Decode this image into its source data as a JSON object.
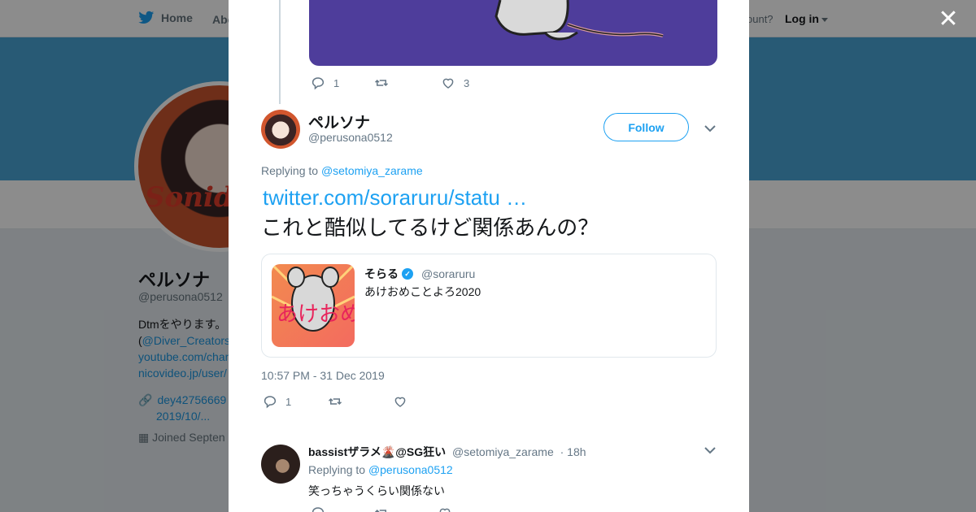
{
  "topbar": {
    "home_label": "Home",
    "about_label": "Abo",
    "account_prompt": "ccount?",
    "login_label": "Log in",
    "twitter_color": "#1da1f2"
  },
  "profile": {
    "avatar_watermark": "Sonid",
    "name": "ペルソナ",
    "handle": "@perusona0512",
    "bio_line1": "Dtmをやります。",
    "bio_line2_prefix": "(",
    "bio_line2_link": "@Diver_Creators",
    "bio_line3": "youtube.com/chan",
    "bio_line4": "nicovideo.jp/user/",
    "website_line1": "dey42756669",
    "website_line2": "2019/10/...",
    "joined": "Joined Septen"
  },
  "modal": {
    "close_icon": "close-icon",
    "previous_tweet": {
      "reply_count": "1",
      "like_count": "3"
    },
    "tweet": {
      "author_name": "ペルソナ",
      "author_handle": "@perusona0512",
      "follow_label": "Follow",
      "replying_to_prefix": "Replying to",
      "replying_to_handle": "@setomiya_zarame",
      "link_text": "twitter.com/soraruru/statu …",
      "text": "これと酷似してるけど関係あんの？",
      "quoted": {
        "name": "そらる",
        "handle": "@soraruru",
        "text": "あけおめことよろ2020",
        "image_text": "あけおめ"
      },
      "timestamp": "10:57 PM - 31 Dec 2019",
      "reply_count": "1"
    },
    "reply": {
      "author_name": "bassistザラメ🌋@SG狂い",
      "author_handle": "@setomiya_zarame",
      "time": "· 18h",
      "replying_to_prefix": "Replying to",
      "replying_to_handle": "@perusona0512",
      "text": "笑っちゃうくらい関係ない"
    }
  }
}
